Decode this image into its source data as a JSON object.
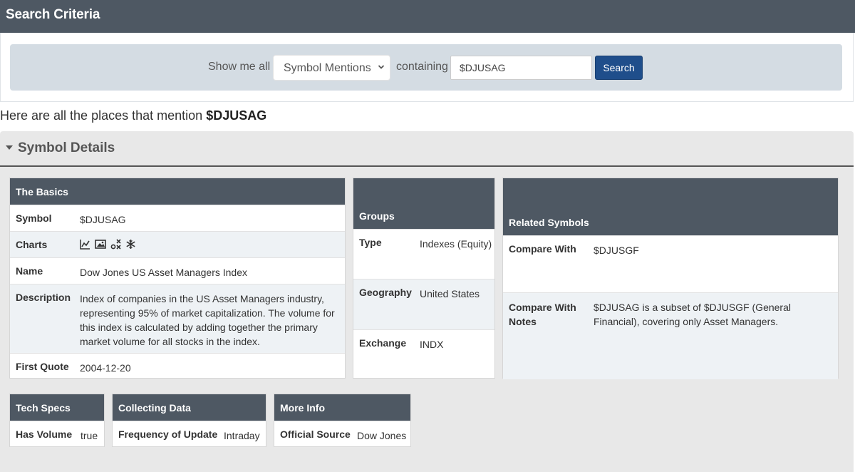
{
  "header": {
    "title": "Search Criteria"
  },
  "criteria": {
    "show_label": "Show me all",
    "select_value": "Symbol Mentions",
    "containing_label": "containing",
    "query": "$DJUSAG",
    "search_button": "Search"
  },
  "mention": {
    "prefix": "Here are all the places that mention",
    "symbol": "$DJUSAG"
  },
  "details": {
    "title": "Symbol Details"
  },
  "basics": {
    "title": "The Basics",
    "rows": [
      {
        "key": "Symbol",
        "value": "$DJUSAG"
      },
      {
        "key": "Charts",
        "icons": [
          "line-chart-icon",
          "image-chart-icon",
          "pnf-chart-icon",
          "snowflake-icon"
        ]
      },
      {
        "key": "Name",
        "value": "Dow Jones US Asset Managers Index"
      },
      {
        "key": "Description",
        "value": "Index of companies in the US Asset Managers industry, representing 95% of market capitalization. The volume for this index is calculated by adding together the primary market volume for all stocks in the index."
      },
      {
        "key": "First Quote",
        "value": "2004-12-20"
      }
    ]
  },
  "groups": {
    "title": "Groups",
    "rows": [
      {
        "key": "Type",
        "value": "Indexes (Equity)"
      },
      {
        "key": "Geography",
        "value": "United States"
      },
      {
        "key": "Exchange",
        "value": "INDX"
      }
    ]
  },
  "related": {
    "title": "Related Symbols",
    "rows": [
      {
        "key": "Compare With",
        "value": "$DJUSGF"
      },
      {
        "key": "Compare With Notes",
        "value": "$DJUSAG is a subset of $DJUSGF (General Financial), covering only Asset Managers."
      }
    ]
  },
  "tech_specs": {
    "title": "Tech Specs",
    "key": "Has Volume",
    "value": "true"
  },
  "collecting": {
    "title": "Collecting Data",
    "key": "Frequency of Update",
    "value": "Intraday"
  },
  "more_info": {
    "title": "More Info",
    "key": "Official Source",
    "value": "Dow Jones"
  },
  "colors": {
    "header": "#4e5863",
    "button": "#1f4e8b",
    "panel": "#e8e8e8",
    "criteria_bg": "#d4dce3"
  }
}
